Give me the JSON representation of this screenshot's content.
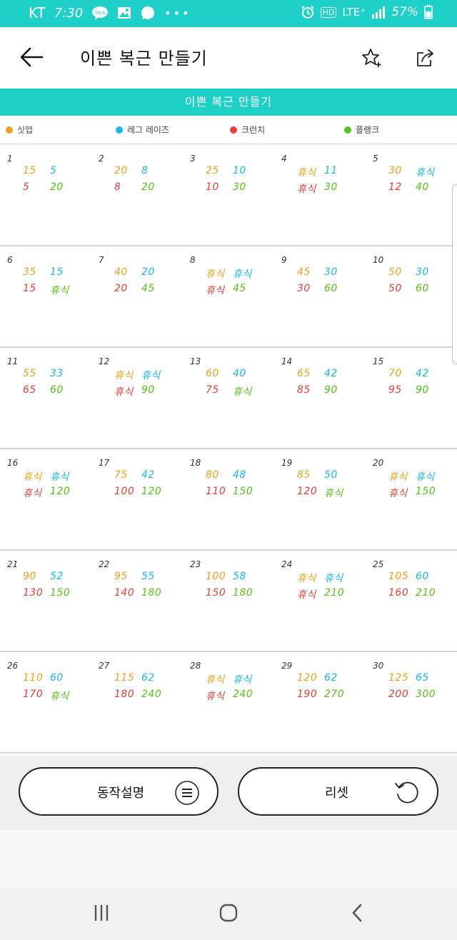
{
  "status_bar": {
    "carrier": "KT",
    "time": "7:30",
    "battery": "57%",
    "hd": "HD",
    "lte": "LTE⁺"
  },
  "header": {
    "title": "이쁜 복근 만들기"
  },
  "banner": {
    "title": "이쁜 복근 만들기"
  },
  "legend": [
    {
      "label": "싯업",
      "color": "#f0a020"
    },
    {
      "label": "레그 레이즈",
      "color": "#1ab8e8"
    },
    {
      "label": "크런치",
      "color": "#e8403c"
    },
    {
      "label": "플랭크",
      "color": "#56c21e"
    }
  ],
  "colors": {
    "situp": "#e5a11f",
    "leg": "#1bb5e6",
    "crunch": "#d9413a",
    "plank": "#58bd1c",
    "accent": "#1ecfc6"
  },
  "days": [
    {
      "day": "1",
      "situp": "15",
      "leg": "5",
      "crunch": "5",
      "plank": "20"
    },
    {
      "day": "2",
      "situp": "20",
      "leg": "8",
      "crunch": "8",
      "plank": "20"
    },
    {
      "day": "3",
      "situp": "25",
      "leg": "10",
      "crunch": "10",
      "plank": "30"
    },
    {
      "day": "4",
      "situp": "휴식",
      "leg": "11",
      "crunch": "휴식",
      "plank": "30"
    },
    {
      "day": "5",
      "situp": "30",
      "leg": "휴식",
      "crunch": "12",
      "plank": "40"
    },
    {
      "day": "6",
      "situp": "35",
      "leg": "15",
      "crunch": "15",
      "plank": "휴식"
    },
    {
      "day": "7",
      "situp": "40",
      "leg": "20",
      "crunch": "20",
      "plank": "45"
    },
    {
      "day": "8",
      "situp": "휴식",
      "leg": "휴식",
      "crunch": "휴식",
      "plank": "45"
    },
    {
      "day": "9",
      "situp": "45",
      "leg": "30",
      "crunch": "30",
      "plank": "60"
    },
    {
      "day": "10",
      "situp": "50",
      "leg": "30",
      "crunch": "50",
      "plank": "60"
    },
    {
      "day": "11",
      "situp": "55",
      "leg": "33",
      "crunch": "65",
      "plank": "60"
    },
    {
      "day": "12",
      "situp": "휴식",
      "leg": "휴식",
      "crunch": "휴식",
      "plank": "90"
    },
    {
      "day": "13",
      "situp": "60",
      "leg": "40",
      "crunch": "75",
      "plank": "휴식"
    },
    {
      "day": "14",
      "situp": "65",
      "leg": "42",
      "crunch": "85",
      "plank": "90"
    },
    {
      "day": "15",
      "situp": "70",
      "leg": "42",
      "crunch": "95",
      "plank": "90"
    },
    {
      "day": "16",
      "situp": "휴식",
      "leg": "휴식",
      "crunch": "휴식",
      "plank": "120"
    },
    {
      "day": "17",
      "situp": "75",
      "leg": "42",
      "crunch": "100",
      "plank": "120"
    },
    {
      "day": "18",
      "situp": "80",
      "leg": "48",
      "crunch": "110",
      "plank": "150"
    },
    {
      "day": "19",
      "situp": "85",
      "leg": "50",
      "crunch": "120",
      "plank": "휴식"
    },
    {
      "day": "20",
      "situp": "휴식",
      "leg": "휴식",
      "crunch": "휴식",
      "plank": "150"
    },
    {
      "day": "21",
      "situp": "90",
      "leg": "52",
      "crunch": "130",
      "plank": "150"
    },
    {
      "day": "22",
      "situp": "95",
      "leg": "55",
      "crunch": "140",
      "plank": "180"
    },
    {
      "day": "23",
      "situp": "100",
      "leg": "58",
      "crunch": "150",
      "plank": "180"
    },
    {
      "day": "24",
      "situp": "휴식",
      "leg": "휴식",
      "crunch": "휴식",
      "plank": "210"
    },
    {
      "day": "25",
      "situp": "105",
      "leg": "60",
      "crunch": "160",
      "plank": "210"
    },
    {
      "day": "26",
      "situp": "110",
      "leg": "60",
      "crunch": "170",
      "plank": "휴식"
    },
    {
      "day": "27",
      "situp": "115",
      "leg": "62",
      "crunch": "180",
      "plank": "240"
    },
    {
      "day": "28",
      "situp": "휴식",
      "leg": "휴식",
      "crunch": "휴식",
      "plank": "240"
    },
    {
      "day": "29",
      "situp": "120",
      "leg": "62",
      "crunch": "190",
      "plank": "270"
    },
    {
      "day": "30",
      "situp": "125",
      "leg": "65",
      "crunch": "200",
      "plank": "300"
    }
  ],
  "buttons": {
    "guide_label": "동작설명",
    "reset_label": "리셋"
  },
  "icons": {
    "back": "arrow-left-icon",
    "favorite": "star-plus-icon",
    "share": "share-icon",
    "menu": "menu-circle-icon",
    "reset": "reset-icon"
  }
}
